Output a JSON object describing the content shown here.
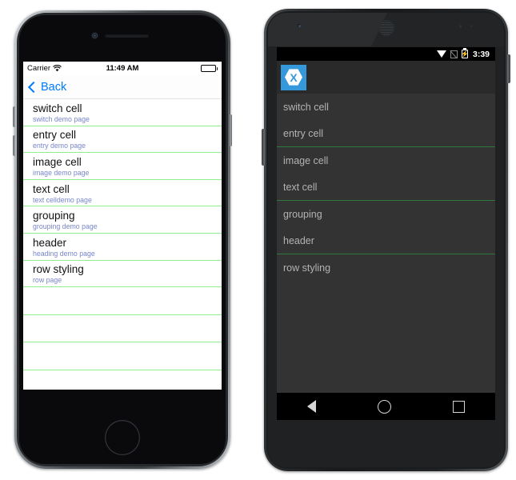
{
  "iphone": {
    "status_bar": {
      "carrier": "Carrier",
      "wifi_icon": "wifi-icon",
      "time": "11:49 AM",
      "battery_icon": "battery-full-icon"
    },
    "nav": {
      "back_label": "Back",
      "back_chevron_icon": "chevron-left-icon"
    },
    "list": [
      {
        "title": "switch cell",
        "subtitle": "switch demo page"
      },
      {
        "title": "entry cell",
        "subtitle": "entry demo page"
      },
      {
        "title": "image cell",
        "subtitle": "image demo page"
      },
      {
        "title": "text cell",
        "subtitle": "text celldemo page"
      },
      {
        "title": "grouping",
        "subtitle": "grouping demo page"
      },
      {
        "title": "header",
        "subtitle": "heading demo page"
      },
      {
        "title": "row styling",
        "subtitle": "row page"
      }
    ],
    "empty_rows": 5,
    "separator_color": "#8cf08c",
    "title_color": "#111111",
    "subtitle_color": "#7986cb",
    "accent_color": "#007aff"
  },
  "android": {
    "status_bar": {
      "wifi_icon": "wifi-icon",
      "signal_icon": "signal-none-icon",
      "battery_icon": "battery-charging-icon",
      "battery_bolt": "⚡",
      "time": "3:39"
    },
    "action_bar": {
      "app_icon": "xamarin-logo-icon",
      "logo_letter": "X"
    },
    "list": [
      {
        "title": "switch cell",
        "separator_after": false
      },
      {
        "title": "entry cell",
        "separator_after": true
      },
      {
        "title": "image cell",
        "separator_after": false
      },
      {
        "title": "text cell",
        "separator_after": true
      },
      {
        "title": "grouping",
        "separator_after": false
      },
      {
        "title": "header",
        "separator_after": true
      },
      {
        "title": "row styling",
        "separator_after": false
      }
    ],
    "nav_bar": {
      "back_icon": "nav-back-icon",
      "home_icon": "nav-home-icon",
      "recents_icon": "nav-recents-icon"
    },
    "background_color": "#333333",
    "action_bar_color": "#2a2a2a",
    "text_color": "#b3b3b3",
    "separator_color": "#2f7a3a",
    "brand_color": "#3498db"
  }
}
